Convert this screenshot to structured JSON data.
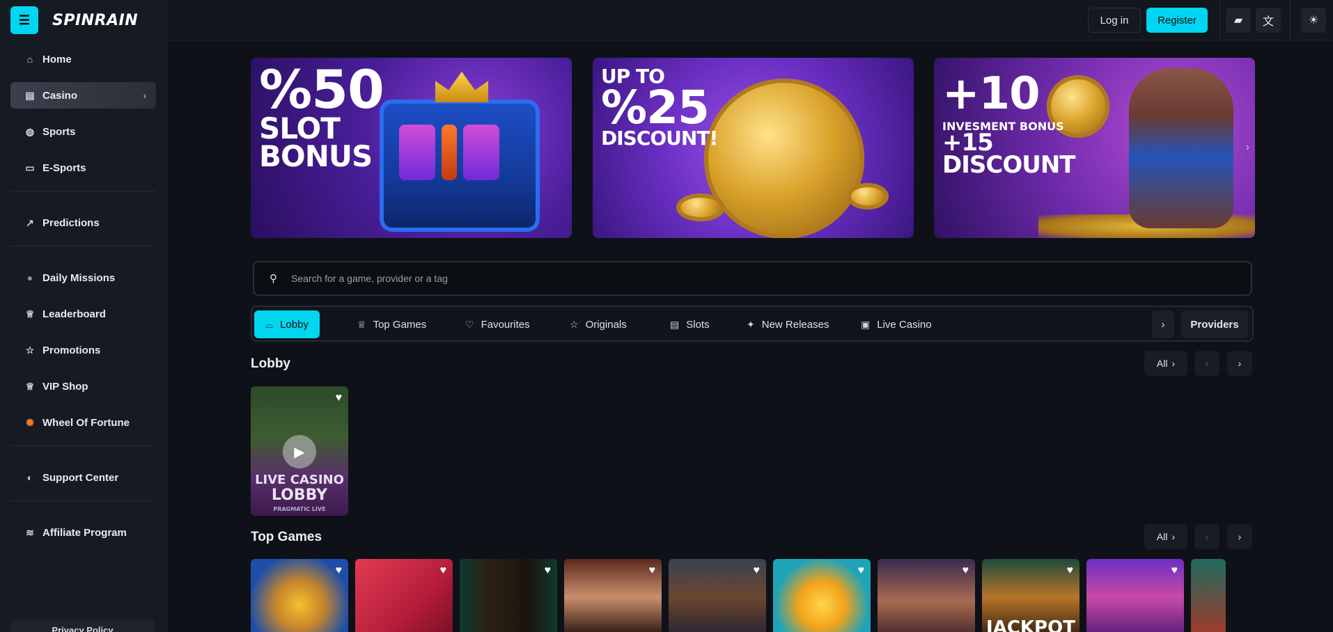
{
  "brand": {
    "logo": "SPINRAIN",
    "menu_icon": "menu-icon"
  },
  "sidebar": {
    "groups": [
      [
        {
          "label": "Home",
          "icon": "home-icon",
          "glyph": "⌂"
        },
        {
          "label": "Casino",
          "icon": "slot-machine-icon",
          "glyph": "▤",
          "active": true
        },
        {
          "label": "Sports",
          "icon": "ball-icon",
          "glyph": "◍"
        },
        {
          "label": "E-Sports",
          "icon": "gamepad-icon",
          "glyph": "▭"
        }
      ],
      [
        {
          "label": "Predictions",
          "icon": "trend-up-icon",
          "glyph": "↗"
        }
      ],
      [
        {
          "label": "Daily Missions",
          "icon": "mission-orb-icon",
          "glyph": "●"
        },
        {
          "label": "Leaderboard",
          "icon": "trophy-icon",
          "glyph": "♕"
        },
        {
          "label": "Promotions",
          "icon": "star-icon",
          "glyph": "☆"
        },
        {
          "label": "VIP Shop",
          "icon": "trophy-icon",
          "glyph": "♕"
        },
        {
          "label": "Wheel Of Fortune",
          "icon": "wheel-icon",
          "glyph": "✺"
        }
      ],
      [
        {
          "label": "Support Center",
          "icon": "headset-icon",
          "glyph": "◐"
        }
      ],
      [
        {
          "label": "Affiliate Program",
          "icon": "handshake-icon",
          "glyph": "≋"
        }
      ]
    ],
    "privacy_label": "Privacy Policy"
  },
  "topbar": {
    "login_label": "Log in",
    "register_label": "Register",
    "icons": [
      "chat-icon",
      "translate-icon",
      "theme-toggle-icon"
    ]
  },
  "banners": [
    {
      "line1": "%50",
      "line2": "SLOT",
      "line3": "BONUS"
    },
    {
      "line1": "UP TO",
      "line2": "%25",
      "line3": "DISCOUNT!"
    },
    {
      "line1": "+10",
      "line2": "INVESMENT BONUS",
      "line3": "+15",
      "line4": "DISCOUNT"
    }
  ],
  "search": {
    "placeholder": "Search for a game, provider or a tag"
  },
  "tabs": [
    {
      "label": "Lobby",
      "icon": "lobby-icon",
      "glyph": "⌓",
      "active": true
    },
    {
      "label": "Top Games",
      "icon": "trophy-icon",
      "glyph": "♕"
    },
    {
      "label": "Favourites",
      "icon": "heart-icon",
      "glyph": "♡"
    },
    {
      "label": "Originals",
      "icon": "star-icon",
      "glyph": "☆"
    },
    {
      "label": "Slots",
      "icon": "slot-machine-icon",
      "glyph": "▤"
    },
    {
      "label": "New Releases",
      "icon": "sparkle-icon",
      "glyph": "✦"
    },
    {
      "label": "Live Casino",
      "icon": "cards-icon",
      "glyph": "▣"
    }
  ],
  "providers_label": "Providers",
  "sections": {
    "lobby": {
      "title": "Lobby",
      "all_label": "All",
      "card": {
        "line1": "LIVE CASINO",
        "line2": "LOBBY",
        "line3": "PRAGMATIC LIVE"
      }
    },
    "top_games": {
      "title": "Top Games",
      "all_label": "All",
      "jackpot_text": "JACKPOT"
    }
  },
  "colors": {
    "accent": "#00d6ef",
    "background": "#0e1117",
    "sidebar": "#161a22"
  }
}
